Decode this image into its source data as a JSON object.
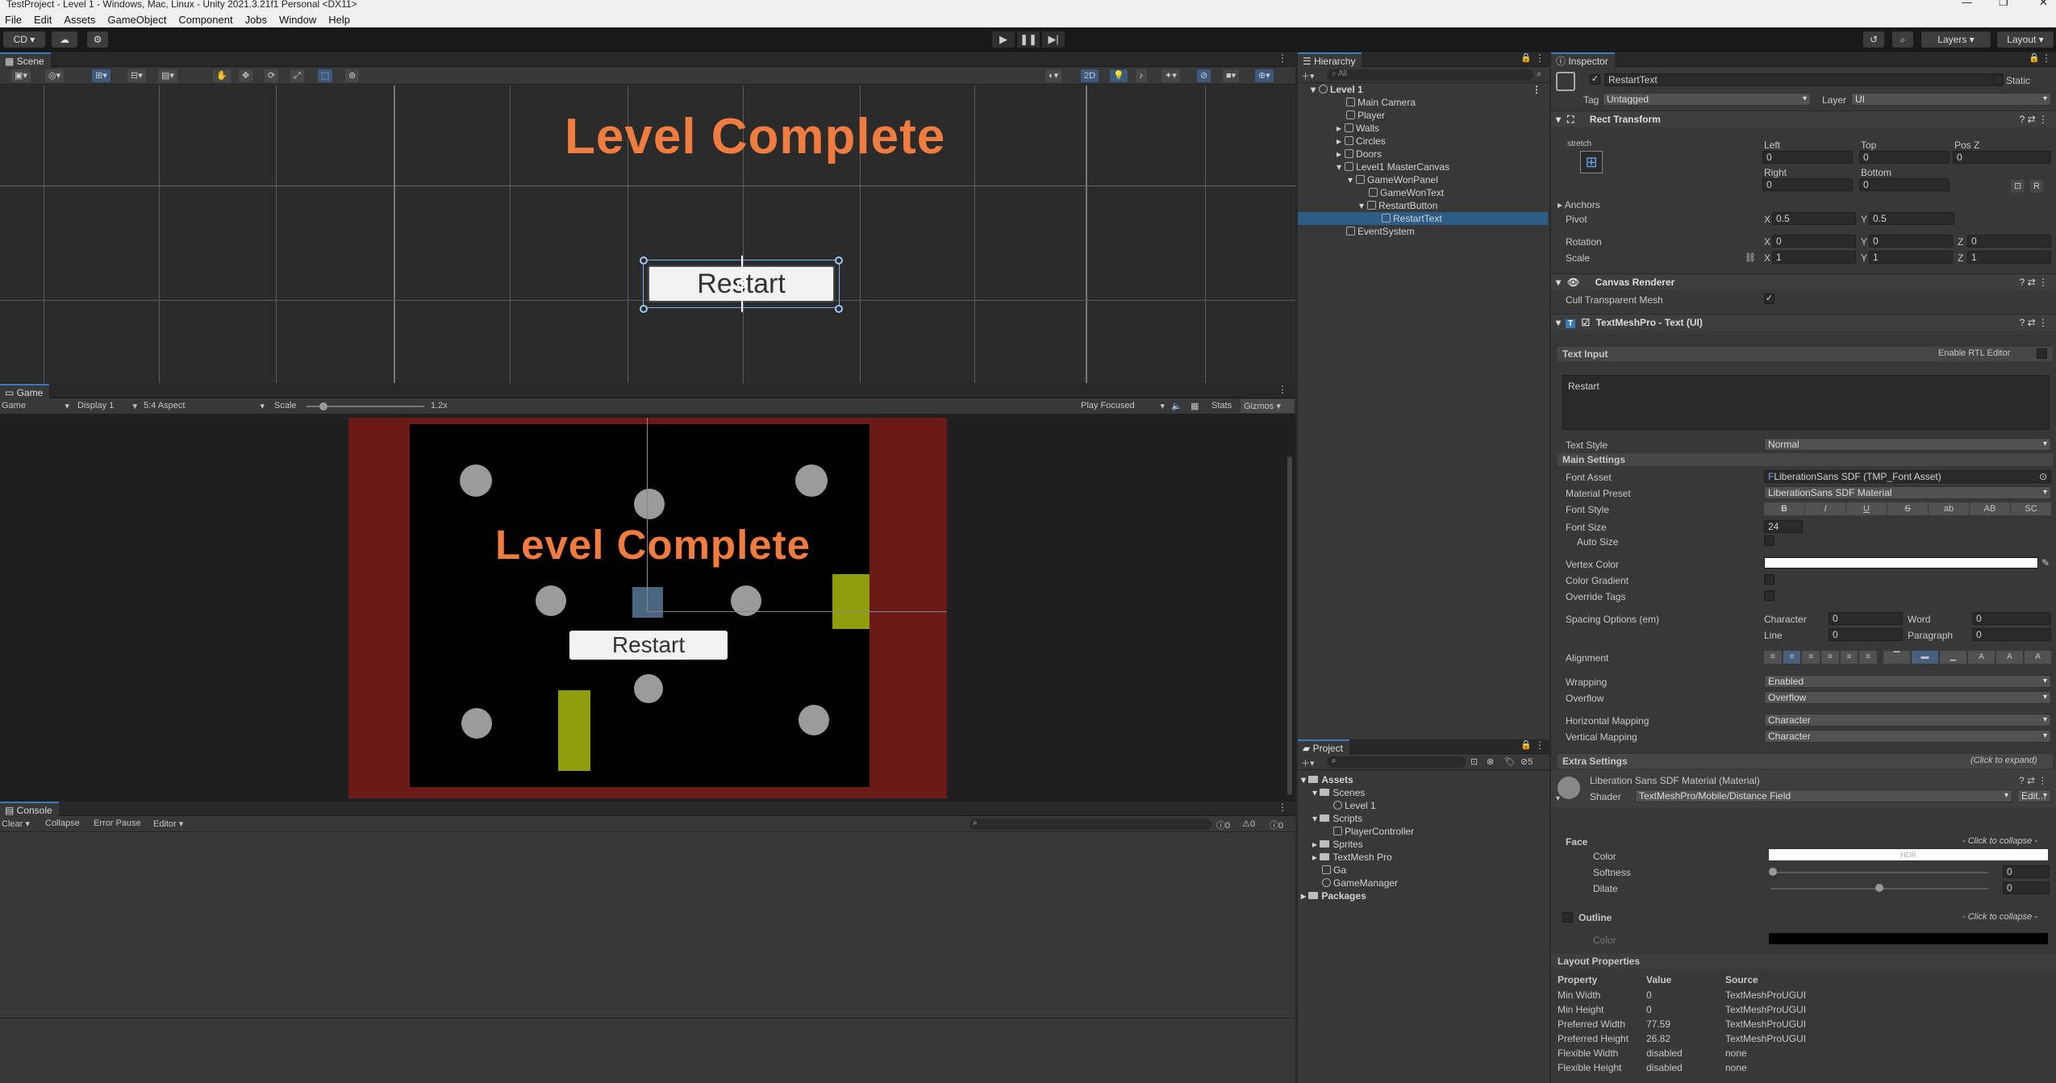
{
  "window": {
    "title": "TestProject - Level 1 - Windows, Mac, Linux - Unity 2021.3.21f1 Personal <DX11>"
  },
  "menu": [
    "File",
    "Edit",
    "Assets",
    "GameObject",
    "Component",
    "Jobs",
    "Window",
    "Help"
  ],
  "toolbar": {
    "account": "CD ▾",
    "layers": "Layers",
    "layout": "Layout"
  },
  "scene": {
    "tab": "Scene",
    "mode2d": "2D",
    "level_text": "Level Complete",
    "restart_text": "Restart"
  },
  "game": {
    "tab": "Game",
    "mode": "Game",
    "display": "Display 1",
    "aspect": "5:4 Aspect",
    "scale_label": "Scale",
    "scale_value": "1.2x",
    "play_focused": "Play Focused",
    "stats": "Stats",
    "gizmos": "Gizmos",
    "level_text": "Level Complete",
    "restart_text": "Restart",
    "colors": {
      "border": "#6b1a18",
      "title": "#f07d3f",
      "bar": "#8f9d0b",
      "square": "#4a6580"
    }
  },
  "console": {
    "tab": "Console",
    "clear": "Clear",
    "collapse": "Collapse",
    "error_pause": "Error Pause",
    "editor": "Editor",
    "counts": [
      "0",
      "0",
      "0"
    ]
  },
  "hierarchy": {
    "tab": "Hierarchy",
    "search_placeholder": "All",
    "rows": [
      {
        "label": "Level 1"
      },
      {
        "label": "Main Camera"
      },
      {
        "label": "Player"
      },
      {
        "label": "Walls"
      },
      {
        "label": "Circles"
      },
      {
        "label": "Doors"
      },
      {
        "label": "Level1 MasterCanvas"
      },
      {
        "label": "GameWonPanel"
      },
      {
        "label": "GameWonText"
      },
      {
        "label": "RestartButton"
      },
      {
        "label": "RestartText"
      },
      {
        "label": "EventSystem"
      }
    ]
  },
  "project": {
    "tab": "Project",
    "badge": "5",
    "rows": [
      {
        "label": "Assets"
      },
      {
        "label": "Scenes"
      },
      {
        "label": "Level 1"
      },
      {
        "label": "Scripts"
      },
      {
        "label": "PlayerController"
      },
      {
        "label": "Sprites"
      },
      {
        "label": "TextMesh Pro"
      },
      {
        "label": "Ga"
      },
      {
        "label": "GameManager"
      },
      {
        "label": "Packages"
      }
    ]
  },
  "inspector": {
    "tab": "Inspector",
    "object_name": "RestartText",
    "static": "Static",
    "tag_label": "Tag",
    "tag": "Untagged",
    "layer_label": "Layer",
    "layer": "UI",
    "rect_transform": {
      "title": "Rect Transform",
      "stretch": "stretch",
      "left_label": "Left",
      "left": "0",
      "top_label": "Top",
      "top": "0",
      "posz_label": "Pos Z",
      "posz": "0",
      "right_label": "Right",
      "right": "0",
      "bottom_label": "Bottom",
      "bottom": "0",
      "anchors": "Anchors",
      "pivot_label": "Pivot",
      "pivot_x": "0.5",
      "pivot_y": "0.5",
      "rotation_label": "Rotation",
      "rot_x": "0",
      "rot_y": "0",
      "rot_z": "0",
      "scale_label": "Scale",
      "scale_x": "1",
      "scale_y": "1",
      "scale_z": "1"
    },
    "canvas_renderer": {
      "title": "Canvas Renderer",
      "cull": "Cull Transparent Mesh"
    },
    "tmp": {
      "title": "TextMeshPro - Text (UI)",
      "text_input": "Text Input",
      "rtl": "Enable RTL Editor",
      "text": "Restart",
      "text_style_label": "Text Style",
      "text_style": "Normal",
      "main_settings": "Main Settings",
      "font_asset_label": "Font Asset",
      "font_asset": "LiberationSans SDF (TMP_Font Asset)",
      "material_preset_label": "Material Preset",
      "material_preset": "LiberationSans SDF Material",
      "font_style_label": "Font Style",
      "font_styles": [
        "B",
        "I",
        "U",
        "S",
        "ab",
        "AB",
        "SC"
      ],
      "font_size_label": "Font Size",
      "font_size": "24",
      "auto_size": "Auto Size",
      "vertex_color": "Vertex Color",
      "color_gradient": "Color Gradient",
      "override_tags": "Override Tags",
      "spacing_label": "Spacing Options (em)",
      "character_label": "Character",
      "character": "0",
      "word_label": "Word",
      "word": "0",
      "line_label": "Line",
      "line": "0",
      "paragraph_label": "Paragraph",
      "paragraph": "0",
      "alignment": "Alignment",
      "wrapping_label": "Wrapping",
      "wrapping": "Enabled",
      "overflow_label": "Overflow",
      "overflow": "Overflow",
      "hmap_label": "Horizontal Mapping",
      "hmap": "Character",
      "vmap_label": "Vertical Mapping",
      "vmap": "Character",
      "extra_settings": "Extra Settings",
      "click_expand": "(Click to expand)"
    },
    "material": {
      "title": "Liberation Sans SDF Material (Material)",
      "shader_label": "Shader",
      "shader": "TextMeshPro/Mobile/Distance Field",
      "edit": "Edit...",
      "face": "Face",
      "click_collapse": "- Click to collapse -",
      "color_label": "Color",
      "hdr": "HDR",
      "softness_label": "Softness",
      "softness": "0",
      "dilate_label": "Dilate",
      "dilate": "0",
      "outline": "Outline",
      "outline_color_label": "Color"
    },
    "layout_props": {
      "title": "Layout Properties",
      "headers": [
        "Property",
        "Value",
        "Source"
      ],
      "rows": [
        [
          "Min Width",
          "0",
          "TextMeshProUGUI"
        ],
        [
          "Min Height",
          "0",
          "TextMeshProUGUI"
        ],
        [
          "Preferred Width",
          "77.59",
          "TextMeshProUGUI"
        ],
        [
          "Preferred Height",
          "26.82",
          "TextMeshProUGUI"
        ],
        [
          "Flexible Width",
          "disabled",
          "none"
        ],
        [
          "Flexible Height",
          "disabled",
          "none"
        ]
      ]
    }
  }
}
